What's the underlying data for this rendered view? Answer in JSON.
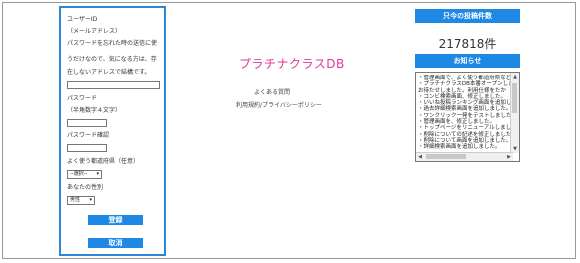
{
  "registration": {
    "user_id_label": "ユーザーID",
    "email_hint": "（メールアドレス）",
    "note_line1": "パスワードを忘れた時の送信に使",
    "note_line2": "うだけなので、気になる方は、存",
    "note_line3": "在しないアドレスで結構です。",
    "email_value": "",
    "password_label": "パスワード",
    "password_hint": "（半角数字４文字）",
    "password_value": "",
    "password_confirm_label": "パスワード確認",
    "password_confirm_value": "",
    "prefecture_label": "よく使う都道府県（任意）",
    "prefecture_selected": "--選択--",
    "gender_label": "あなたの性別",
    "gender_selected": "男性",
    "register_button": "登録",
    "cancel_button": "取消"
  },
  "center": {
    "logo_text": "プラチナクラスDB",
    "faq_link": "よくある質問",
    "terms_link": "利用規約/プライバシーポリシー"
  },
  "right": {
    "post_count_header": "只今の投稿件数",
    "post_count": "217818件",
    "notice_header": "お知らせ",
    "notices": [
      "・管理画面で、よく使う都道府県などを",
      "・プラチナクラスDB本番オープンしまし",
      "お待たせしました。利用仕様をたか",
      "・コンビ検索画面、修正しました。",
      "・いいね投稿ランキング画面を追加し",
      "・過去詳細検索画面を追加しました。",
      "・ワンクリック一発をテストしました。",
      "・管理画面を、修正しました。",
      "・トップページをリニューアルしました",
      "・削除についての記述を修正しました。",
      "・削除について画面を追加しました。",
      "・詳細検索画面を追加しました。"
    ]
  }
}
